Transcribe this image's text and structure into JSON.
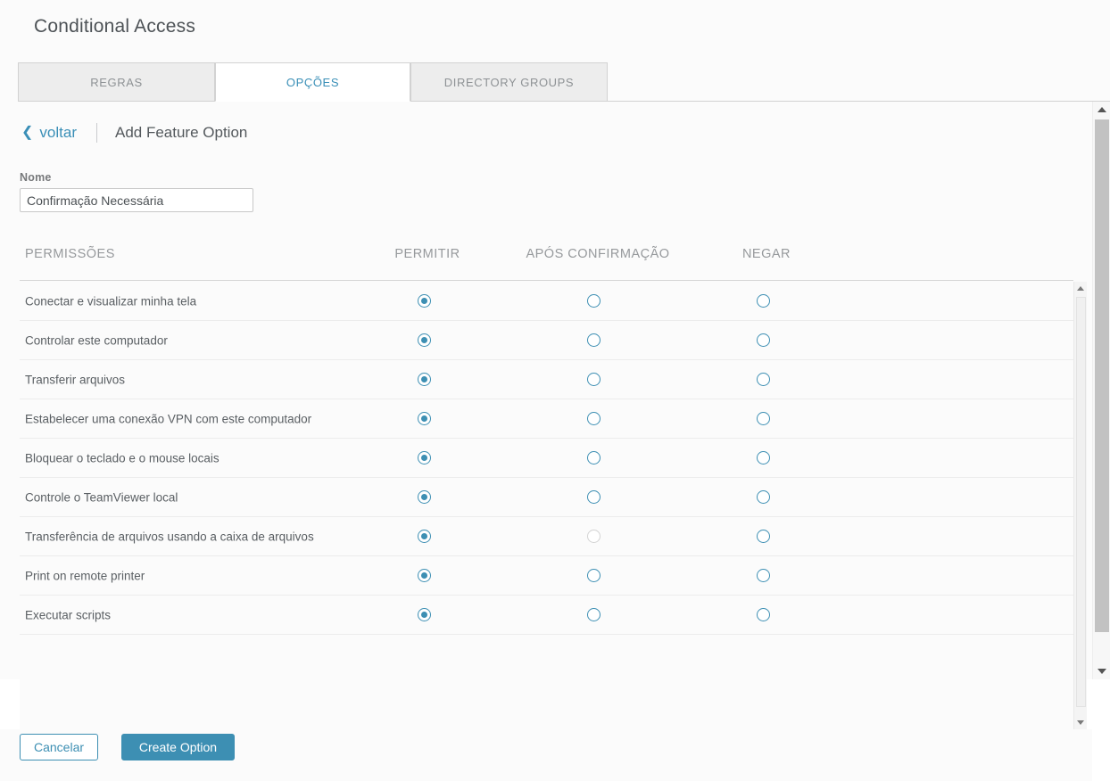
{
  "header": {
    "title": "Conditional Access"
  },
  "tabs": [
    {
      "id": "regras",
      "label": "REGRAS",
      "active": false
    },
    {
      "id": "opcoes",
      "label": "OPÇÕES",
      "active": true
    },
    {
      "id": "directory-groups",
      "label": "DIRECTORY GROUPS",
      "active": false
    }
  ],
  "subheader": {
    "back_chevron": "❮",
    "back_label": "voltar",
    "title": "Add Feature Option"
  },
  "form": {
    "name_label": "Nome",
    "name_value": "Confirmação Necessária",
    "name_placeholder": ""
  },
  "table": {
    "columns": [
      "PERMISSÕES",
      "PERMITIR",
      "APÓS CONFIRMAÇÃO",
      "NEGAR"
    ],
    "rows": [
      {
        "label": "Conectar e visualizar minha tela",
        "selected": "allow",
        "confirm_disabled": false
      },
      {
        "label": "Controlar este computador",
        "selected": "allow",
        "confirm_disabled": false
      },
      {
        "label": "Transferir arquivos",
        "selected": "allow",
        "confirm_disabled": false
      },
      {
        "label": "Estabelecer uma conexão VPN com este computador",
        "selected": "allow",
        "confirm_disabled": false
      },
      {
        "label": "Bloquear o teclado e o mouse locais",
        "selected": "allow",
        "confirm_disabled": false
      },
      {
        "label": "Controle o TeamViewer local",
        "selected": "allow",
        "confirm_disabled": false
      },
      {
        "label": "Transferência de arquivos usando a caixa de arquivos",
        "selected": "allow",
        "confirm_disabled": true
      },
      {
        "label": "Print on remote printer",
        "selected": "allow",
        "confirm_disabled": false
      },
      {
        "label": "Executar scripts",
        "selected": "allow",
        "confirm_disabled": false
      }
    ]
  },
  "footer": {
    "cancel_label": "Cancelar",
    "create_label": "Create Option"
  },
  "scrollbars": {
    "up_arrow": "▲",
    "down_arrow": "▼"
  },
  "colors": {
    "accent": "#3d8fb3",
    "page_background": "#fbfbfb",
    "title_text": "#4d5256",
    "muted_text": "#96999c",
    "row_border": "#ececec"
  }
}
